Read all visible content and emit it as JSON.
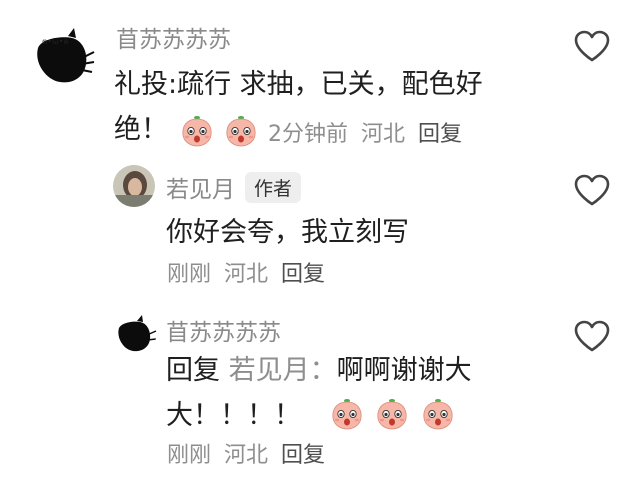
{
  "comments": [
    {
      "user": "苜苏苏苏苏",
      "text": "礼投:疏行 求抽，已关，配色好绝！",
      "time": "2分钟前",
      "location": "河北",
      "reply_label": "回复",
      "emoji_count": 2
    },
    {
      "user": "若见月",
      "badge": "作者",
      "text": "你好会夸，我立刻写",
      "time": "刚刚",
      "location": "河北",
      "reply_label": "回复"
    },
    {
      "user": "苜苏苏苏苏",
      "prefix": "回复",
      "reply_to": "若见月",
      "colon": "：",
      "text_line1": "啊啊谢谢大",
      "text_line2": "大！！！！",
      "time": "刚刚",
      "location": "河北",
      "reply_label": "回复",
      "emoji_count": 3
    }
  ],
  "icons": {
    "like": "heart-outline-icon",
    "emoji": "peach-face-emoji-icon"
  },
  "colors": {
    "name": "#8a8a8a",
    "meta": "#8e8e8e",
    "text": "#1f1f1f",
    "badge_bg": "#eeeeee"
  }
}
